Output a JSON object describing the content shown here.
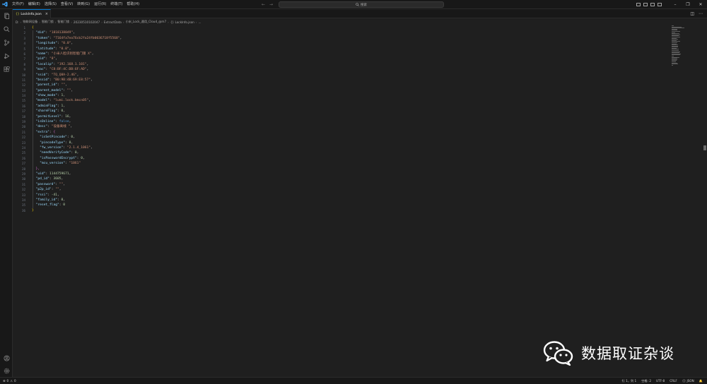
{
  "menu": [
    "文件(F)",
    "编辑(E)",
    "选择(S)",
    "查看(V)",
    "转到(G)",
    "运行(R)",
    "终端(T)",
    "帮助(H)"
  ],
  "search": {
    "label": "搜索"
  },
  "tab": {
    "label": "LockInfo.json",
    "icon": "{}",
    "close": "×"
  },
  "breadcrumb": [
    "D:",
    "物联网设备",
    "智能门锁",
    "智能门锁",
    "20230510102047",
    "ExtractData",
    "小米_Lock_通用_Cloud_@m7",
    "{} LockInfo.json",
    "..."
  ],
  "editor": {
    "line_numbers": [
      "1",
      "2",
      "3",
      "4",
      "5",
      "6",
      "7",
      "8",
      "9",
      "10",
      "11",
      "12",
      "13",
      "14",
      "15",
      "16",
      "17",
      "18",
      "19",
      "20",
      "21",
      "22",
      "23",
      "24",
      "25",
      "26",
      "27",
      "28",
      "29",
      "30",
      "31",
      "32",
      "33",
      "34",
      "35",
      "36"
    ],
    "lines": [
      {
        "indent": "",
        "key": "",
        "value": "",
        "open": "{"
      },
      {
        "indent": "  ",
        "key": "\"did\"",
        "value": "\"1818138049\"",
        "vtype": "s"
      },
      {
        "indent": "  ",
        "key": "\"token\"",
        "value": "\"7164fa7ea76cb2fa24fb0036718f5568\"",
        "vtype": "s"
      },
      {
        "indent": "  ",
        "key": "\"longitude\"",
        "value": "\"0.0\"",
        "vtype": "s"
      },
      {
        "indent": "  ",
        "key": "\"latitude\"",
        "value": "\"0.0\"",
        "vtype": "s"
      },
      {
        "indent": "  ",
        "key": "\"name\"",
        "value": "\"小米人脸识别智能门锁 X\"",
        "vtype": "s"
      },
      {
        "indent": "  ",
        "key": "\"pid\"",
        "value": "\"8\"",
        "vtype": "s"
      },
      {
        "indent": "  ",
        "key": "\"localip\"",
        "value": "\"192.168.1.101\"",
        "vtype": "s"
      },
      {
        "indent": "  ",
        "key": "\"mac\"",
        "value": "\"C8:BF:4C:DB:6F:AD\"",
        "vtype": "s"
      },
      {
        "indent": "  ",
        "key": "\"ssid\"",
        "value": "\"TQ_Q8A-2.4G\"",
        "vtype": "s"
      },
      {
        "indent": "  ",
        "key": "\"bssid\"",
        "value": "\"B0:9B:4B:69:E8:57\"",
        "vtype": "s"
      },
      {
        "indent": "  ",
        "key": "\"parent_id\"",
        "value": "\"\"",
        "vtype": "s"
      },
      {
        "indent": "  ",
        "key": "\"parent_model\"",
        "value": "\"\"",
        "vtype": "s"
      },
      {
        "indent": "  ",
        "key": "\"show_mode\"",
        "value": "1",
        "vtype": "n"
      },
      {
        "indent": "  ",
        "key": "\"model\"",
        "value": "\"lumi.lock.bmcn05\"",
        "vtype": "s"
      },
      {
        "indent": "  ",
        "key": "\"adminFlag\"",
        "value": "1",
        "vtype": "n"
      },
      {
        "indent": "  ",
        "key": "\"shareFlag\"",
        "value": "0",
        "vtype": "n"
      },
      {
        "indent": "  ",
        "key": "\"permitLevel\"",
        "value": "16",
        "vtype": "n"
      },
      {
        "indent": "  ",
        "key": "\"isOnline\"",
        "value": "false",
        "vtype": "b"
      },
      {
        "indent": "  ",
        "key": "\"desc\"",
        "value": "\"设备离线 \"",
        "vtype": "s"
      },
      {
        "indent": "  ",
        "key": "\"extra\"",
        "value": "",
        "open2": "{"
      },
      {
        "indent": "    ",
        "key": "\"isSetPincode\"",
        "value": "0",
        "vtype": "n"
      },
      {
        "indent": "    ",
        "key": "\"pincodeType\"",
        "value": "0",
        "vtype": "n"
      },
      {
        "indent": "    ",
        "key": "\"fw_version\"",
        "value": "\"2.1.4_1061\"",
        "vtype": "s"
      },
      {
        "indent": "    ",
        "key": "\"needVerifyCode\"",
        "value": "0",
        "vtype": "n"
      },
      {
        "indent": "    ",
        "key": "\"isPasswordEncrypt\"",
        "value": "0",
        "vtype": "n"
      },
      {
        "indent": "    ",
        "key": "\"mcu_version\"",
        "value": "\"1061\"",
        "vtype": "s",
        "last": true
      },
      {
        "indent": "  ",
        "key": "",
        "value": "",
        "close2": "},"
      },
      {
        "indent": "  ",
        "key": "\"uid\"",
        "value": "1144759671",
        "vtype": "n"
      },
      {
        "indent": "  ",
        "key": "\"pd_id\"",
        "value": "3605",
        "vtype": "n"
      },
      {
        "indent": "  ",
        "key": "\"password\"",
        "value": "\"\"",
        "vtype": "s"
      },
      {
        "indent": "  ",
        "key": "\"p2p_id\"",
        "value": "\"\"",
        "vtype": "s"
      },
      {
        "indent": "  ",
        "key": "\"rssi\"",
        "value": "-41",
        "vtype": "n"
      },
      {
        "indent": "  ",
        "key": "\"family_id\"",
        "value": "0",
        "vtype": "n"
      },
      {
        "indent": "  ",
        "key": "\"reset_flag\"",
        "value": "0",
        "vtype": "n",
        "last": true
      },
      {
        "indent": "",
        "key": "",
        "value": "",
        "close": "}"
      }
    ]
  },
  "watermark": {
    "text": "数据取证杂谈"
  },
  "status": {
    "errors": "0",
    "warnings": "0",
    "position": "行 1，列 1",
    "spaces": "空格: 2",
    "encoding": "UTF-8",
    "eol": "CRLF",
    "language": "{} JSON"
  },
  "colors": {
    "accent": "#0078d4",
    "editor_bg": "#1f1f1f",
    "chrome_bg": "#181818",
    "key": "#9cdcfe",
    "string": "#ce9178",
    "number": "#b5cea8"
  }
}
